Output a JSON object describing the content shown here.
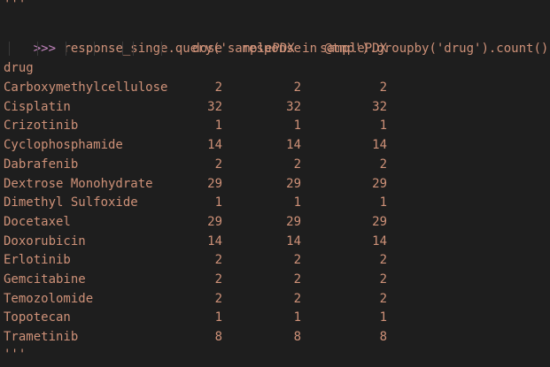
{
  "terminal": {
    "open_quotes": "'''",
    "close_quotes": "'''",
    "prompt": ">>>",
    "command": " response_singe.query('samplePDX in @tmp').groupby('drug').count()",
    "index_name": "drug",
    "columns": [
      "dose",
      "response",
      "samplePDX"
    ],
    "rows": [
      {
        "drug": "Carboxymethylcellulose",
        "dose": "2",
        "response": "2",
        "samplePDX": "2"
      },
      {
        "drug": "Cisplatin",
        "dose": "32",
        "response": "32",
        "samplePDX": "32"
      },
      {
        "drug": "Crizotinib",
        "dose": "1",
        "response": "1",
        "samplePDX": "1"
      },
      {
        "drug": "Cyclophosphamide",
        "dose": "14",
        "response": "14",
        "samplePDX": "14"
      },
      {
        "drug": "Dabrafenib",
        "dose": "2",
        "response": "2",
        "samplePDX": "2"
      },
      {
        "drug": "Dextrose Monohydrate",
        "dose": "29",
        "response": "29",
        "samplePDX": "29"
      },
      {
        "drug": "Dimethyl Sulfoxide",
        "dose": "1",
        "response": "1",
        "samplePDX": "1"
      },
      {
        "drug": "Docetaxel",
        "dose": "29",
        "response": "29",
        "samplePDX": "29"
      },
      {
        "drug": "Doxorubicin",
        "dose": "14",
        "response": "14",
        "samplePDX": "14"
      },
      {
        "drug": "Erlotinib",
        "dose": "2",
        "response": "2",
        "samplePDX": "2"
      },
      {
        "drug": "Gemcitabine",
        "dose": "2",
        "response": "2",
        "samplePDX": "2"
      },
      {
        "drug": "Temozolomide",
        "dose": "2",
        "response": "2",
        "samplePDX": "2"
      },
      {
        "drug": "Topotecan",
        "dose": "1",
        "response": "1",
        "samplePDX": "1"
      },
      {
        "drug": "Trametinib",
        "dose": "8",
        "response": "8",
        "samplePDX": "8"
      }
    ],
    "colors": {
      "background": "#1e1e1e",
      "text": "#ce9178",
      "prompt": "#c586c0",
      "indent_guide": "#3a3a3a"
    }
  }
}
